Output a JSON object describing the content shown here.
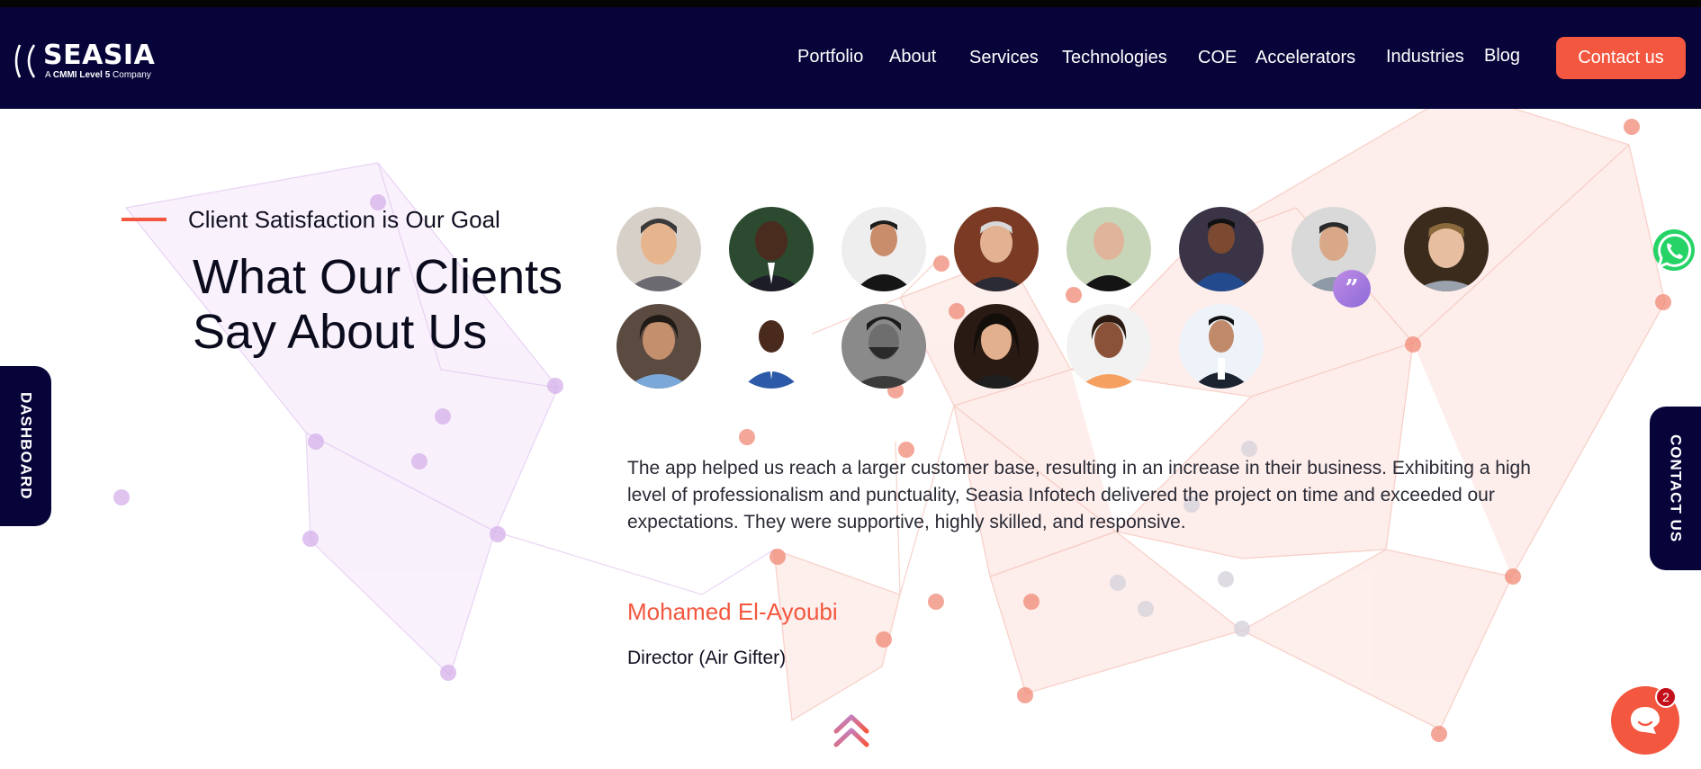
{
  "brand": {
    "name": "SEASIA",
    "tagline_prefix": "A ",
    "tagline_bold": "CMMI Level 5",
    "tagline_suffix": " Company"
  },
  "nav": {
    "items": [
      "Portfolio",
      "About",
      "Services",
      "Technologies",
      "COE",
      "Accelerators",
      "Industries",
      "Blog"
    ],
    "contact_label": "Contact us"
  },
  "section": {
    "eyebrow": "Client Satisfaction is Our Goal",
    "title_line1": "What Our Clients",
    "title_line2": "Say About Us"
  },
  "testimonial": {
    "quote": "The app helped us reach a larger customer base, resulting in an increase in their business. Exhibiting a high level of professionalism and punctuality, Seasia Infotech delivered the project on time and exceeded our expectations. They were supportive, highly skilled, and responsive.",
    "author": "Mohamed El-Ayoubi",
    "role": "Director (Air Gifter)",
    "quote_mark": "”"
  },
  "side_tabs": {
    "dashboard": "DASHBOARD",
    "contact": "CONTACT US"
  },
  "chat": {
    "unread_count": "2"
  },
  "icons": {
    "whatsapp": "whatsapp-icon",
    "chat": "chat-bubble-icon",
    "scroll_top": "double-chevron-up-icon"
  },
  "colors": {
    "navy": "#07043a",
    "accent": "#f3573f",
    "purple": "#b78ce0"
  }
}
